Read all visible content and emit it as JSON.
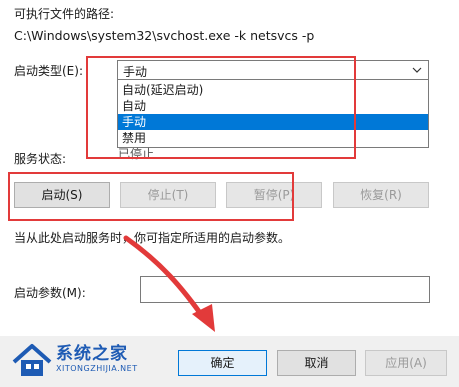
{
  "window": {
    "path_label": "可执行文件的路径:",
    "path_value": "C:\\Windows\\system32\\svchost.exe -k netsvcs -p"
  },
  "startup": {
    "label": "启动类型(E):",
    "selected": "手动",
    "options": [
      "自动(延迟启动)",
      "自动",
      "手动",
      "禁用"
    ],
    "highlighted_index": 2
  },
  "status": {
    "label": "服务状态:",
    "value": "已停止"
  },
  "controls": {
    "start": "启动(S)",
    "stop": "停止(T)",
    "pause": "暂停(P)",
    "resume": "恢复(R)"
  },
  "hint": "当从此处启动服务时，你可指定所适用的启动参数。",
  "params": {
    "label": "启动参数(M):",
    "value": ""
  },
  "dialog_buttons": {
    "ok": "确定",
    "cancel": "取消",
    "apply": "应用(A)"
  },
  "watermark": {
    "title": "系统之家",
    "subtitle": "XITONGZHIJIA.NET"
  },
  "colors": {
    "annotation_red": "#e23a3a",
    "selection_blue": "#0078d7",
    "watermark_blue": "#1e5bb4"
  },
  "icons": {
    "combo_arrow": "chevron-down-icon",
    "annotation_arrow": "arrow-down-right-icon",
    "watermark_logo": "house-logo-icon"
  }
}
